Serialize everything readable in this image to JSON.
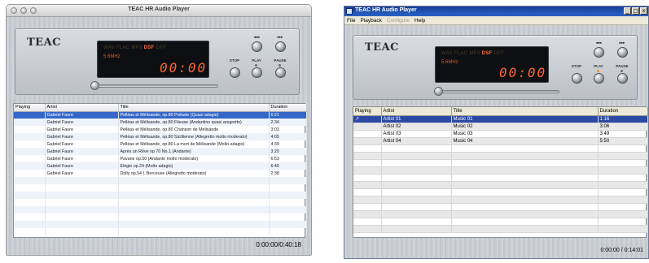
{
  "mac_window": {
    "title": "TEAC HR Audio Player",
    "brand": "TEAC",
    "display": {
      "formats": [
        "WAV",
        "FLAC",
        "MP3"
      ],
      "active_format": "DSF",
      "inactive_suffix": "OFF",
      "sample_rate": "5.6MHz",
      "time": "00:00"
    },
    "controls": {
      "prev_label": "◂◂◂",
      "next_label": "▸▸▸",
      "stop_label": "STOP",
      "play_label": "PLAY",
      "pause_label": "PAUSE"
    },
    "columns": [
      "Playing",
      "Artist",
      "Title",
      "Duration"
    ],
    "tracks": [
      {
        "playing": "",
        "artist": "Gabriel Faure",
        "title": "Pelléas et Mélisande, op.80 Prélude (Quasi adagio)",
        "duration": "6:21"
      },
      {
        "playing": "",
        "artist": "Gabriel Faure",
        "title": "Pelléas et Mélisande, op.80 Fileuse (Andantino quasi aregretto)",
        "duration": "2:34"
      },
      {
        "playing": "",
        "artist": "Gabriel Faure",
        "title": "Pelléas et Mélisande, op.80 Chanson de Mélisande",
        "duration": "3:03"
      },
      {
        "playing": "",
        "artist": "Gabriel Faure",
        "title": "Pelléas et Mélisande, op.80 Sicillienne (Allegretto molto moderato)",
        "duration": "4:05"
      },
      {
        "playing": "",
        "artist": "Gabriel Faure",
        "title": "Pelléas et Mélisande, op.80 La mort de Mélisande (Molto adagio)",
        "duration": "4:39"
      },
      {
        "playing": "",
        "artist": "Gabriel Faure",
        "title": "Après un Rêve op 70 No.1 (Andante)",
        "duration": "3:20"
      },
      {
        "playing": "",
        "artist": "Gabriel Faure",
        "title": "Pavane op.50 (Andante molto moderato)",
        "duration": "6:53"
      },
      {
        "playing": "",
        "artist": "Gabriel Faure",
        "title": "Elégie op.24 (Molto adagio)",
        "duration": "6:45"
      },
      {
        "playing": "",
        "artist": "Gabriel Faure",
        "title": "Dolly op.54 I. Berceuse (Allegretto moderato)",
        "duration": "2:38"
      }
    ],
    "selected_index": 0,
    "total_time": "0:00:00/0:40:18"
  },
  "win_window": {
    "title": "TEAC HR Audio Player",
    "menu": [
      "File",
      "Playback",
      "Configure",
      "Help"
    ],
    "menu_disabled": [
      false,
      false,
      true,
      false
    ],
    "title_buttons": [
      "_",
      "□",
      "x"
    ],
    "brand": "TEAC",
    "display": {
      "formats": [
        "WAV",
        "FLAC",
        "MP3"
      ],
      "active_format": "DSF",
      "inactive_suffix": "OFF",
      "sample_rate": "5.6MHz",
      "time": "00:00"
    },
    "controls": {
      "prev_label": "◂◂◂",
      "next_label": "▸▸▸",
      "stop_label": "STOP",
      "play_label": "PLAY",
      "pause_label": "PAUSE"
    },
    "columns": [
      "Playing",
      "Artist",
      "Title",
      "Duration"
    ],
    "tracks": [
      {
        "playing": "↗",
        "artist": "Artist 01",
        "title": "Music 01",
        "duration": "1:16"
      },
      {
        "playing": "",
        "artist": "Artist 02",
        "title": "Music 02",
        "duration": "3:06"
      },
      {
        "playing": "",
        "artist": "Artist 03",
        "title": "Music 03",
        "duration": "3:49"
      },
      {
        "playing": "",
        "artist": "Artist 04",
        "title": "Music 04",
        "duration": "5:50"
      }
    ],
    "selected_index": 0,
    "total_time": "0:00:00 / 0:14:01"
  },
  "colors": {
    "selection_mac": "#3467c9",
    "selection_win": "#2b4aa5",
    "display_text": "#ff6633",
    "titlebar_win": "#1f52b4"
  }
}
